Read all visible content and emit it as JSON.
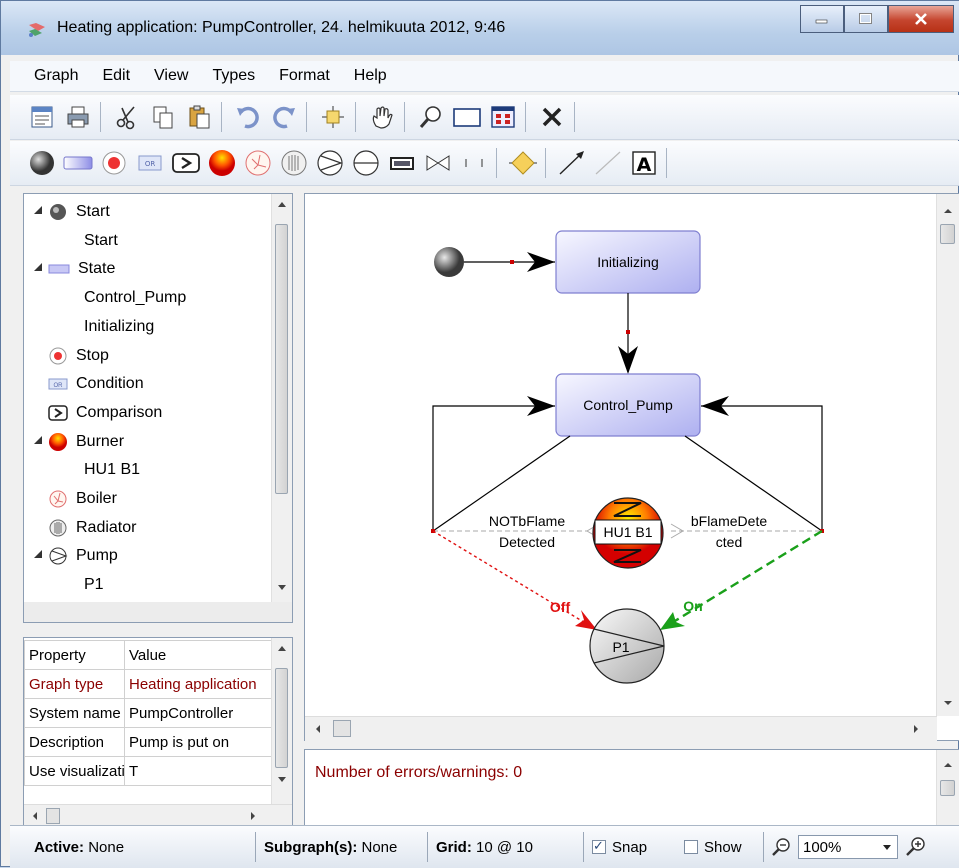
{
  "window": {
    "title": "Heating application: PumpController, 24. helmikuuta 2012, 9:46"
  },
  "menu": [
    "Graph",
    "Edit",
    "View",
    "Types",
    "Format",
    "Help"
  ],
  "tree": [
    {
      "label": "Start",
      "icon": "start-ball-icon",
      "level": 0,
      "expand": true
    },
    {
      "label": "Start",
      "level": 1
    },
    {
      "label": "State",
      "icon": "state-rect-icon",
      "level": 0,
      "expand": true
    },
    {
      "label": "Control_Pump",
      "level": 1
    },
    {
      "label": "Initializing",
      "level": 1
    },
    {
      "label": "Stop",
      "icon": "stop-icon",
      "level": 0
    },
    {
      "label": "Condition",
      "icon": "condition-icon",
      "level": 0
    },
    {
      "label": "Comparison",
      "icon": "comparison-icon",
      "level": 0
    },
    {
      "label": "Burner",
      "icon": "burner-icon",
      "level": 0,
      "expand": true
    },
    {
      "label": "HU1 B1",
      "level": 1
    },
    {
      "label": "Boiler",
      "icon": "boiler-icon",
      "level": 0
    },
    {
      "label": "Radiator",
      "icon": "radiator-icon",
      "level": 0
    },
    {
      "label": "Pump",
      "icon": "pump-icon",
      "level": 0,
      "expand": true
    },
    {
      "label": "P1",
      "level": 1
    }
  ],
  "props": {
    "headers": [
      "Property",
      "Value"
    ],
    "rows": [
      [
        "Graph type",
        "Heating application"
      ],
      [
        "System name",
        "PumpController"
      ],
      [
        "Description",
        "Pump is put on"
      ],
      [
        "Use visualization",
        "T"
      ]
    ]
  },
  "diagram": {
    "initial_state": "Initializing",
    "state": "Control_Pump",
    "burner": "HU1 B1",
    "pump": "P1",
    "cond_left_1": "NOTbFlame",
    "cond_left_2": "Detected",
    "cond_right_1": "bFlameDete",
    "cond_right_2": "cted",
    "off_label": "Off",
    "on_label": "On"
  },
  "output": {
    "text": "Number of errors/warnings: 0"
  },
  "status": {
    "active_label": "Active:",
    "active_value": "None",
    "subgraph_label": "Subgraph(s):",
    "subgraph_value": "None",
    "grid_label": "Grid:",
    "grid_value": "10 @ 10",
    "snap_label": "Snap",
    "snap_checked": true,
    "show_label": "Show",
    "show_checked": false,
    "zoom": "100%"
  },
  "colors": {
    "off": "#e01010",
    "on": "#1aa01a",
    "state_fill_start": "#f4f4ff",
    "state_fill_end": "#b8b8f2",
    "cond_text": "#8b0000"
  }
}
